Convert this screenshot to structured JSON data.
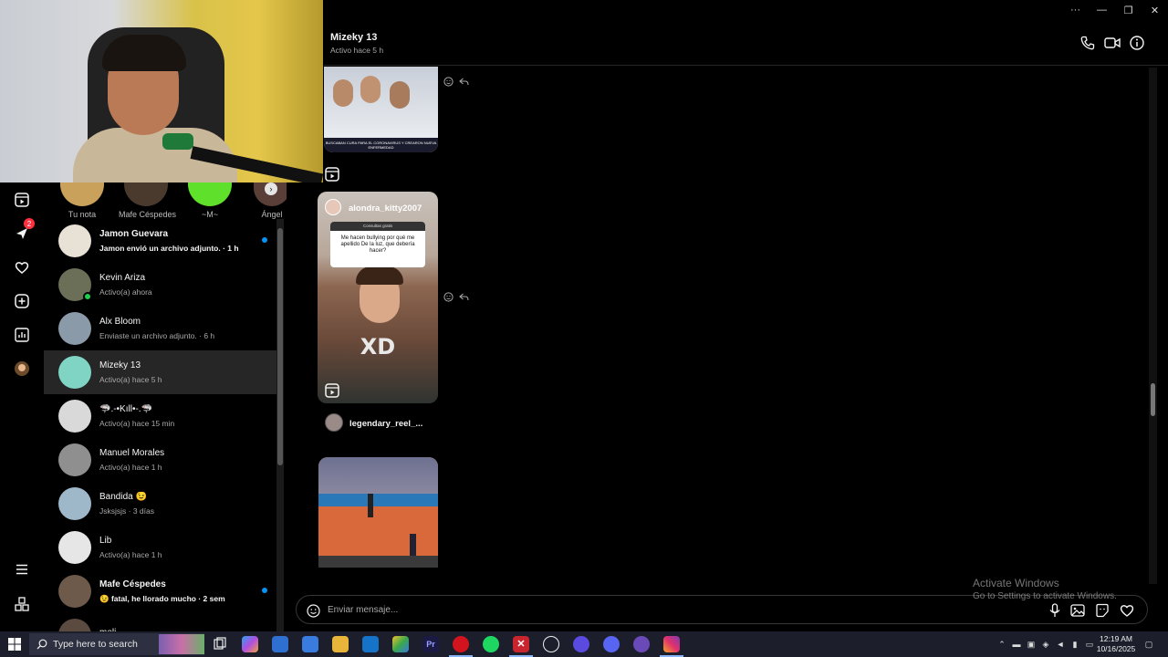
{
  "chat": {
    "name": "Mizeky 13",
    "status": "Activo hace 5 h",
    "composer_placeholder": "Enviar mensaje...",
    "shared": [
      {
        "card_title": "BUSCABAN CURA PARA EL CORONAVIRUS Y CREARON NUEVA ENFERMEDAD"
      },
      {
        "user": "alondra_kitty2007",
        "question_header": "Consultas gratis",
        "question": "Me hacen bullying por qué me apellido De la luz, que debería hacer?",
        "overlay": "XD"
      },
      {
        "user": "legendary_reel_..."
      }
    ]
  },
  "notes": [
    {
      "label": "Tu nota"
    },
    {
      "label": "Mafe Céspedes"
    },
    {
      "label": "~M~"
    },
    {
      "label": "Ángel"
    }
  ],
  "rail": {
    "notifications_badge": "2"
  },
  "conversations": [
    {
      "name": "Jamon Guevara",
      "snippet": "Jamon envió un archivo adjunto. · 1 h",
      "unread": true,
      "color": "#e8e1d6"
    },
    {
      "name": "Kevin Ariza",
      "snippet": "Activo(a) ahora",
      "online": true,
      "color": "#6b6f58"
    },
    {
      "name": "Alx Bloom",
      "snippet": "Enviaste un archivo adjunto. · 6 h",
      "color": "#8a9aa8"
    },
    {
      "name": "Mizeky 13",
      "snippet": "Activo(a) hace 5 h",
      "active": true,
      "color": "#7fd4c4"
    },
    {
      "name": "🦈.-•Kıll•-.🦈",
      "snippet": "Activo(a) hace 15 min",
      "color": "#d9d9d9"
    },
    {
      "name": "Manuel Morales",
      "snippet": "Activo(a) hace 1 h",
      "color": "#8f8f8f"
    },
    {
      "name": "Bandida 😉",
      "snippet": "Jsksjsjs · 3 días",
      "color": "#9eb7c9"
    },
    {
      "name": "Lib",
      "snippet": "Activo(a) hace 1 h",
      "color": "#e6e6e6"
    },
    {
      "name": "Mafe Céspedes",
      "snippet": "😉 fatal, he llorado mucho · 2 sem",
      "unread": true,
      "color": "#6d5a4a"
    },
    {
      "name": "meli",
      "snippet": "",
      "color": "#5a4a40"
    }
  ],
  "watermark": {
    "line1": "Activate Windows",
    "line2": "Go to Settings to activate Windows."
  },
  "taskbar": {
    "search_placeholder": "Type here to search",
    "time": "12:19 AM",
    "date": "10/16/2025"
  },
  "colors": {
    "accent": "#0095f6",
    "badge": "#ff3040",
    "online": "#1cd14f",
    "active_row": "#262626"
  }
}
